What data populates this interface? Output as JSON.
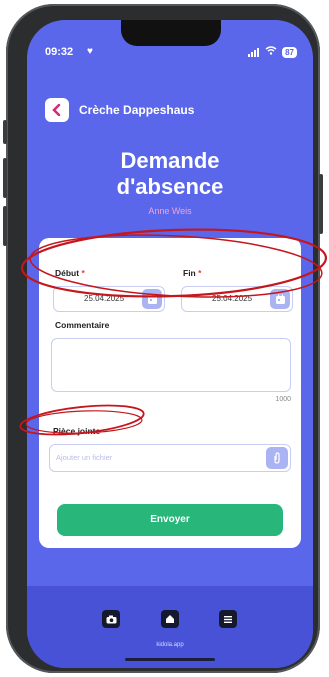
{
  "status": {
    "time": "09:32",
    "battery": "87"
  },
  "header": {
    "app_title": "Crèche Dappeshaus"
  },
  "page": {
    "title_line1": "Demande",
    "title_line2": "d'absence",
    "user_name": "Anne Weis"
  },
  "form": {
    "start": {
      "label": "Début",
      "required": "*",
      "value": "25.04.2025"
    },
    "end": {
      "label": "Fin",
      "required": "*",
      "value": "25.04.2025"
    },
    "comment": {
      "label": "Commentaire",
      "counter": "1000",
      "value": ""
    },
    "attachment": {
      "label": "Pièce jointe",
      "placeholder": "Ajouter un fichier"
    },
    "submit_label": "Envoyer"
  },
  "footer": {
    "domain": "kidola.app"
  },
  "colors": {
    "background": "#5b67ea",
    "submit": "#28b67a",
    "annotation": "#c4161c"
  }
}
